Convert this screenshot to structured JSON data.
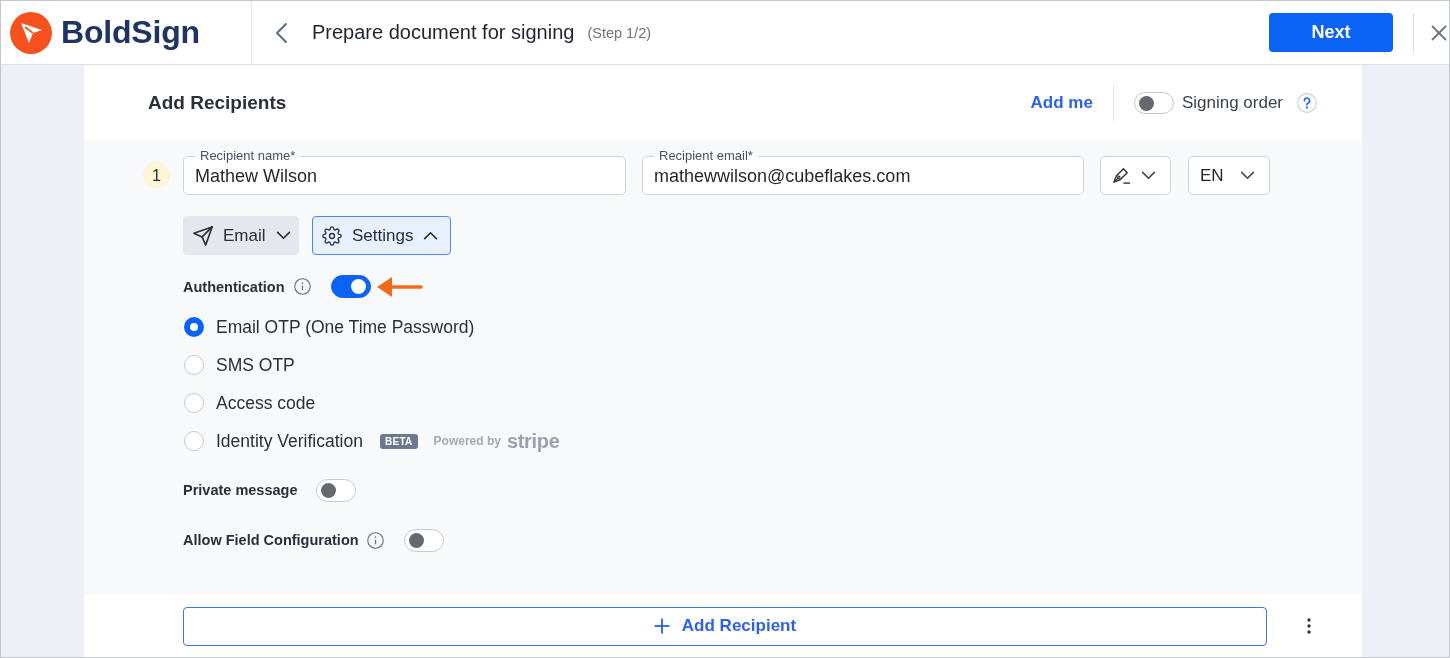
{
  "header": {
    "logo_text": "BoldSign",
    "title": "Prepare document for signing",
    "step": "(Step 1/2)",
    "next_button": "Next"
  },
  "recipients_header": {
    "title": "Add Recipients",
    "add_me_link": "Add me",
    "signing_order": {
      "label": "Signing order",
      "on": false
    }
  },
  "recipients": [
    {
      "number": "1",
      "name_field": {
        "label": "Recipient name*",
        "value": "Mathew Wilson"
      },
      "email_field": {
        "label": "Recipient email*",
        "value": "mathewwilson@cubeflakes.com"
      },
      "language": "EN",
      "delivery_button": "Email",
      "settings_button": {
        "label": "Settings",
        "expanded": true
      },
      "authentication": {
        "label": "Authentication",
        "on": true,
        "options": [
          {
            "label": "Email OTP (One Time Password)",
            "selected": true
          },
          {
            "label": "SMS OTP",
            "selected": false
          },
          {
            "label": "Access code",
            "selected": false
          },
          {
            "label": "Identity Verification",
            "selected": false,
            "badge": "BETA",
            "powered_by": "Powered by",
            "provider": "stripe"
          }
        ]
      },
      "private_message": {
        "label": "Private message",
        "on": false
      },
      "field_configuration": {
        "label": "Allow Field Configuration",
        "on": false
      }
    }
  ],
  "add_recipient_button": "Add Recipient"
}
